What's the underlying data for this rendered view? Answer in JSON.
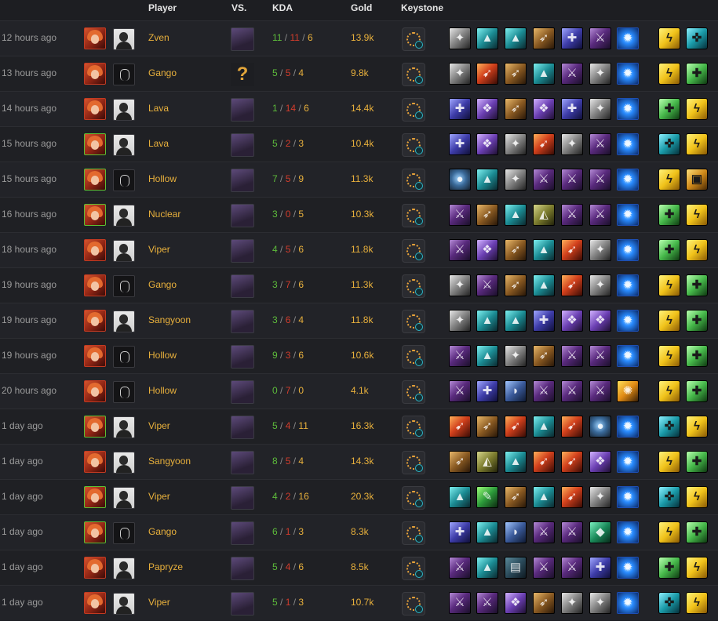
{
  "header": {
    "player": "Player",
    "vs": "VS.",
    "kda": "KDA",
    "gold": "Gold",
    "keystone": "Keystone"
  },
  "item_styles": {
    "sword": {
      "bg": "linear-gradient(135deg,#b48ad6 0%,#5a2a7e 45%,#1b0f2a 100%)",
      "glyph": "⚔"
    },
    "teal": {
      "bg": "linear-gradient(135deg,#7ef0f0 0%,#1b8c94 50%,#0b2a30 100%)",
      "glyph": "▲"
    },
    "gun": {
      "bg": "linear-gradient(135deg,#e7e7e7 0%,#8a8a8a 45%,#232323 100%)",
      "glyph": "✦"
    },
    "bow": {
      "bg": "linear-gradient(135deg,#e9b86a 0%,#8a5a22 50%,#2a1808 100%)",
      "glyph": "➶"
    },
    "staff": {
      "bg": "linear-gradient(135deg,#9fa6ff 0%,#3d3ca8 50%,#10103a 100%)",
      "glyph": "✚"
    },
    "red": {
      "bg": "linear-gradient(135deg,#ffb05a 0%,#d2401c 45%,#3a0c05 100%)",
      "glyph": "➹"
    },
    "ward": {
      "bg": "radial-gradient(circle at 50% 50%,#bfe7ff 0%,#2a8cff 35%,#0b2a6a 100%)",
      "glyph": "✹"
    },
    "purple": {
      "bg": "linear-gradient(135deg,#d1b2ff 0%,#6b3fb3 50%,#1f1033 100%)",
      "glyph": "❖"
    },
    "yellowhat": {
      "bg": "linear-gradient(135deg,#d6d68a 0%,#7c7c2e 50%,#23230a 100%)",
      "glyph": "◭"
    },
    "boots": {
      "bg": "linear-gradient(135deg,#a2c6ff 0%,#3a5a9a 50%,#0f1a33 100%)",
      "glyph": "◗"
    },
    "orb": {
      "bg": "radial-gradient(circle at 45% 45%,#9fd4ff 0%,#3a6a9a 45%,#161f2a 100%)",
      "glyph": "●"
    },
    "flame": {
      "bg": "linear-gradient(135deg,#ffe05a 0%,#e08a14 50%,#3a2005 100%)",
      "glyph": "✺"
    },
    "jaw": {
      "bg": "linear-gradient(135deg,#5a8a9a 0%,#2a4a5a 50%,#0f1a22 100%)",
      "glyph": "▤"
    },
    "green": {
      "bg": "linear-gradient(135deg,#9cff7a 0%,#2c9a3a 50%,#0c2a10 100%)",
      "glyph": "✎"
    },
    "greeneye": {
      "bg": "linear-gradient(135deg,#7af0c0 0%,#1a8a5a 50%,#082a1a 100%)",
      "glyph": "◆"
    }
  },
  "spell_styles": {
    "flash": {
      "bg": "linear-gradient(135deg,#fff27a 0%,#f0c21a 50%,#8a5a05 100%)",
      "glyph": "ϟ"
    },
    "heal": {
      "bg": "linear-gradient(135deg,#b8ffb0 0%,#46b84a 50%,#0f3a12 100%)",
      "glyph": "✚"
    },
    "cleanse": {
      "bg": "linear-gradient(135deg,#8cf0ff 0%,#1a9aa8 50%,#06303a 100%)",
      "glyph": "✜"
    },
    "barrier": {
      "bg": "linear-gradient(135deg,#ffe07a 0%,#d08a1a 50%,#4a2a05 100%)",
      "glyph": "▣"
    }
  },
  "rows": [
    {
      "time": "12 hours ago",
      "champ_border": "red",
      "pro": "photo",
      "player": "Zven",
      "vs": "champ",
      "k": "11",
      "d": "11",
      "a": "6",
      "gold": "13.9k",
      "items": [
        "gun",
        "teal",
        "teal",
        "bow",
        "staff",
        "sword",
        "ward"
      ],
      "spells": [
        "flash",
        "cleanse"
      ]
    },
    {
      "time": "13 hours ago",
      "champ_border": "red",
      "pro": "silhouette",
      "player": "Gango",
      "vs": "unknown",
      "vs_text": "?",
      "k": "5",
      "d": "5",
      "a": "4",
      "gold": "9.8k",
      "items": [
        "gun",
        "red",
        "bow",
        "teal",
        "sword",
        "gun",
        "ward"
      ],
      "spells": [
        "flash",
        "heal"
      ]
    },
    {
      "time": "14 hours ago",
      "champ_border": "red",
      "pro": "photo",
      "player": "Lava",
      "vs": "champ",
      "k": "1",
      "d": "14",
      "a": "6",
      "gold": "14.4k",
      "items": [
        "staff",
        "purple",
        "bow",
        "purple",
        "staff",
        "gun",
        "ward"
      ],
      "spells": [
        "heal",
        "flash"
      ]
    },
    {
      "time": "15 hours ago",
      "champ_border": "green",
      "pro": "photo",
      "player": "Lava",
      "vs": "champ",
      "k": "5",
      "d": "2",
      "a": "3",
      "gold": "10.4k",
      "items": [
        "staff",
        "purple",
        "gun",
        "red",
        "gun",
        "sword",
        "ward"
      ],
      "spells": [
        "cleanse",
        "flash"
      ]
    },
    {
      "time": "15 hours ago",
      "champ_border": "green",
      "pro": "silhouette",
      "player": "Hollow",
      "vs": "champ",
      "k": "7",
      "d": "5",
      "a": "9",
      "gold": "11.3k",
      "items": [
        "orb",
        "teal",
        "gun",
        "sword",
        "sword",
        "sword",
        "ward"
      ],
      "spells": [
        "flash",
        "barrier"
      ]
    },
    {
      "time": "16 hours ago",
      "champ_border": "green",
      "pro": "photo",
      "player": "Nuclear",
      "vs": "champ",
      "k": "3",
      "d": "0",
      "a": "5",
      "gold": "10.3k",
      "items": [
        "sword",
        "bow",
        "teal",
        "yellowhat",
        "sword",
        "sword",
        "ward"
      ],
      "spells": [
        "heal",
        "flash"
      ]
    },
    {
      "time": "18 hours ago",
      "champ_border": "red",
      "pro": "photo",
      "player": "Viper",
      "vs": "champ",
      "k": "4",
      "d": "5",
      "a": "6",
      "gold": "11.8k",
      "items": [
        "sword",
        "purple",
        "bow",
        "teal",
        "red",
        "gun",
        "ward"
      ],
      "spells": [
        "heal",
        "flash"
      ]
    },
    {
      "time": "19 hours ago",
      "champ_border": "red",
      "pro": "silhouette",
      "player": "Gango",
      "vs": "champ",
      "k": "3",
      "d": "7",
      "a": "6",
      "gold": "11.3k",
      "items": [
        "gun",
        "sword",
        "bow",
        "teal",
        "red",
        "gun",
        "ward"
      ],
      "spells": [
        "flash",
        "heal"
      ]
    },
    {
      "time": "19 hours ago",
      "champ_border": "red",
      "pro": "photo",
      "player": "Sangyoon",
      "vs": "champ",
      "k": "3",
      "d": "6",
      "a": "4",
      "gold": "11.8k",
      "items": [
        "gun",
        "teal",
        "teal",
        "staff",
        "purple",
        "purple",
        "ward"
      ],
      "spells": [
        "flash",
        "heal"
      ]
    },
    {
      "time": "19 hours ago",
      "champ_border": "red",
      "pro": "silhouette",
      "player": "Hollow",
      "vs": "champ",
      "k": "9",
      "d": "3",
      "a": "6",
      "gold": "10.6k",
      "items": [
        "sword",
        "teal",
        "gun",
        "bow",
        "sword",
        "sword",
        "ward"
      ],
      "spells": [
        "flash",
        "heal"
      ]
    },
    {
      "time": "20 hours ago",
      "champ_border": "red",
      "pro": "silhouette",
      "player": "Hollow",
      "vs": "champ",
      "k": "0",
      "d": "7",
      "a": "0",
      "gold": "4.1k",
      "items": [
        "sword",
        "staff",
        "boots",
        "sword",
        "sword",
        "sword",
        "flame"
      ],
      "spells": [
        "flash",
        "heal"
      ]
    },
    {
      "time": "1 day ago",
      "champ_border": "green",
      "pro": "photo",
      "player": "Viper",
      "vs": "champ",
      "k": "5",
      "d": "4",
      "a": "11",
      "gold": "16.3k",
      "items": [
        "red",
        "bow",
        "red",
        "teal",
        "red",
        "orb",
        "ward"
      ],
      "spells": [
        "cleanse",
        "flash"
      ]
    },
    {
      "time": "1 day ago",
      "champ_border": "red",
      "pro": "photo",
      "player": "Sangyoon",
      "vs": "champ",
      "k": "8",
      "d": "5",
      "a": "4",
      "gold": "14.3k",
      "items": [
        "bow",
        "yellowhat",
        "teal",
        "red",
        "red",
        "purple",
        "ward"
      ],
      "spells": [
        "flash",
        "heal"
      ]
    },
    {
      "time": "1 day ago",
      "champ_border": "green",
      "pro": "photo",
      "player": "Viper",
      "vs": "champ",
      "k": "4",
      "d": "2",
      "a": "16",
      "gold": "20.3k",
      "items": [
        "teal",
        "green",
        "bow",
        "teal",
        "red",
        "gun",
        "ward"
      ],
      "spells": [
        "cleanse",
        "flash"
      ]
    },
    {
      "time": "1 day ago",
      "champ_border": "green",
      "pro": "silhouette",
      "player": "Gango",
      "vs": "champ",
      "k": "6",
      "d": "1",
      "a": "3",
      "gold": "8.3k",
      "items": [
        "staff",
        "teal",
        "boots",
        "sword",
        "sword",
        "greeneye",
        "ward"
      ],
      "spells": [
        "flash",
        "heal"
      ]
    },
    {
      "time": "1 day ago",
      "champ_border": "red",
      "pro": "photo",
      "player": "Papryze",
      "vs": "champ",
      "k": "5",
      "d": "4",
      "a": "6",
      "gold": "8.5k",
      "items": [
        "sword",
        "teal",
        "jaw",
        "sword",
        "sword",
        "staff",
        "ward"
      ],
      "spells": [
        "heal",
        "flash"
      ]
    },
    {
      "time": "1 day ago",
      "champ_border": "red",
      "pro": "photo",
      "player": "Viper",
      "vs": "champ",
      "k": "5",
      "d": "1",
      "a": "3",
      "gold": "10.7k",
      "items": [
        "sword",
        "sword",
        "purple",
        "bow",
        "gun",
        "gun",
        "ward"
      ],
      "spells": [
        "cleanse",
        "flash"
      ]
    }
  ]
}
